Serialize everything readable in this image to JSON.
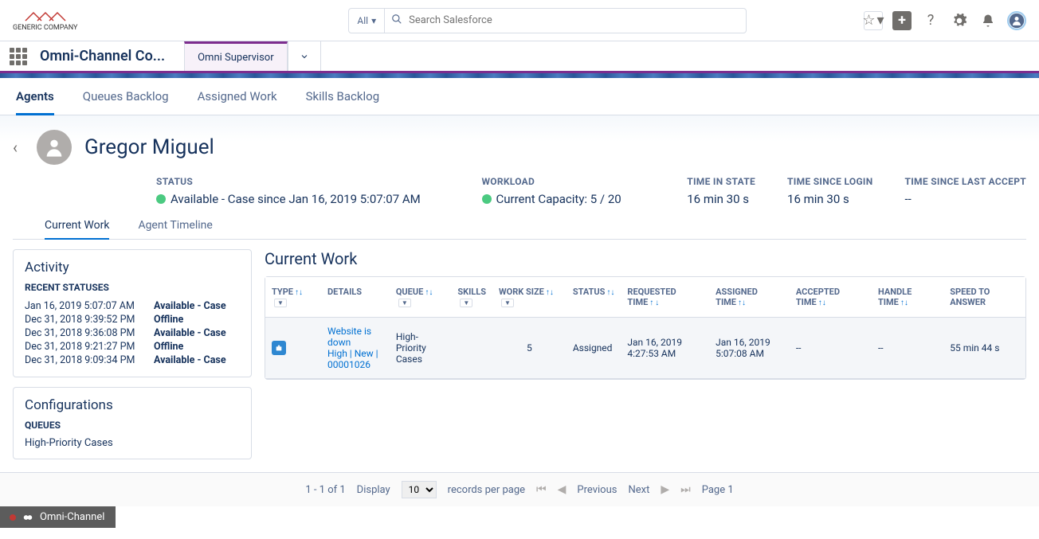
{
  "logo_text": "GENERIC COMPANY",
  "search": {
    "all_label": "All",
    "placeholder": "Search Salesforce"
  },
  "nav": {
    "app_name": "Omni-Channel Co...",
    "tab": "Omni Supervisor"
  },
  "primary_tabs": [
    "Agents",
    "Queues Backlog",
    "Assigned Work",
    "Skills Backlog"
  ],
  "agent": {
    "name": "Gregor Miguel"
  },
  "stats": {
    "status_label": "STATUS",
    "status_value": "Available - Case  since  Jan 16, 2019 5:07:07 AM",
    "workload_label": "WORKLOAD",
    "workload_value": "Current Capacity:  5 / 20",
    "time_in_state_label": "TIME IN STATE",
    "time_in_state_value": "16 min 30 s",
    "time_since_login_label": "TIME SINCE LOGIN",
    "time_since_login_value": "16 min 30 s",
    "time_since_accept_label": "TIME SINCE LAST ACCEPT",
    "time_since_accept_value": "--"
  },
  "sub_tabs": [
    "Current Work",
    "Agent Timeline"
  ],
  "activity": {
    "title": "Activity",
    "subtitle": "RECENT STATUSES",
    "rows": [
      {
        "time": "Jan 16, 2019 5:07:07 AM",
        "status": "Available - Case"
      },
      {
        "time": "Dec 31, 2018 9:39:52 PM",
        "status": "Offline"
      },
      {
        "time": "Dec 31, 2018 9:36:08 PM",
        "status": "Available - Case"
      },
      {
        "time": "Dec 31, 2018 9:21:27 PM",
        "status": "Offline"
      },
      {
        "time": "Dec 31, 2018 9:09:34 PM",
        "status": "Available - Case"
      }
    ]
  },
  "config": {
    "title": "Configurations",
    "subtitle": "QUEUES",
    "queue0": "High-Priority Cases"
  },
  "current_work": {
    "title": "Current Work",
    "headers": {
      "type": "TYPE",
      "details": "DETAILS",
      "queue": "QUEUE",
      "skills": "SKILLS",
      "work_size": "WORK SIZE",
      "status": "STATUS",
      "requested": "REQUESTED TIME",
      "assigned": "ASSIGNED TIME",
      "accepted": "ACCEPTED TIME",
      "handle": "HANDLE TIME",
      "speed": "SPEED TO ANSWER"
    },
    "rows": [
      {
        "details_line1": "Website is down",
        "details_line2": "High | New | 00001026",
        "queue": "High-Priority Cases",
        "skills": "",
        "work_size": "5",
        "status": "Assigned",
        "requested": "Jan 16, 2019 4:27:53 AM",
        "assigned": "Jan 16, 2019 5:07:08 AM",
        "accepted": "--",
        "handle": "--",
        "speed": "55 min 44 s"
      }
    ]
  },
  "pager": {
    "range": "1 - 1 of 1",
    "display": "Display",
    "per_page": "10",
    "records": "records per page",
    "prev": "Previous",
    "next": "Next",
    "page": "Page 1"
  },
  "footer": {
    "label": "Omni-Channel"
  }
}
